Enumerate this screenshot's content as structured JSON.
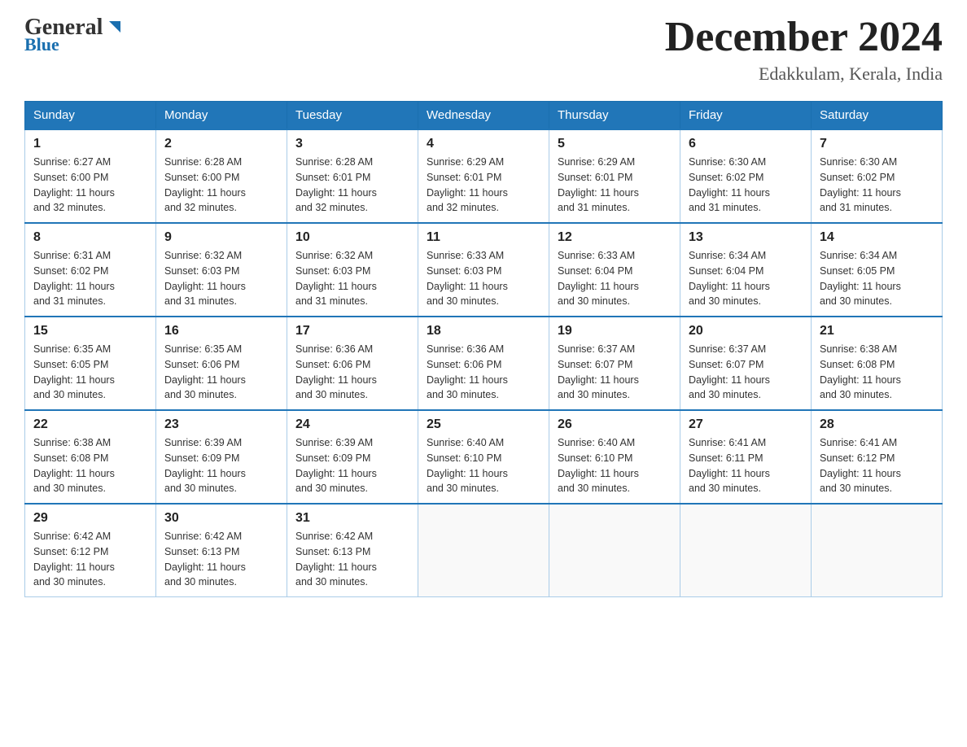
{
  "header": {
    "logo_general": "General",
    "logo_blue": "Blue",
    "month_title": "December 2024",
    "location": "Edakkulam, Kerala, India"
  },
  "weekdays": [
    "Sunday",
    "Monday",
    "Tuesday",
    "Wednesday",
    "Thursday",
    "Friday",
    "Saturday"
  ],
  "weeks": [
    [
      {
        "num": "1",
        "sunrise": "6:27 AM",
        "sunset": "6:00 PM",
        "daylight": "11 hours and 32 minutes."
      },
      {
        "num": "2",
        "sunrise": "6:28 AM",
        "sunset": "6:00 PM",
        "daylight": "11 hours and 32 minutes."
      },
      {
        "num": "3",
        "sunrise": "6:28 AM",
        "sunset": "6:01 PM",
        "daylight": "11 hours and 32 minutes."
      },
      {
        "num": "4",
        "sunrise": "6:29 AM",
        "sunset": "6:01 PM",
        "daylight": "11 hours and 32 minutes."
      },
      {
        "num": "5",
        "sunrise": "6:29 AM",
        "sunset": "6:01 PM",
        "daylight": "11 hours and 31 minutes."
      },
      {
        "num": "6",
        "sunrise": "6:30 AM",
        "sunset": "6:02 PM",
        "daylight": "11 hours and 31 minutes."
      },
      {
        "num": "7",
        "sunrise": "6:30 AM",
        "sunset": "6:02 PM",
        "daylight": "11 hours and 31 minutes."
      }
    ],
    [
      {
        "num": "8",
        "sunrise": "6:31 AM",
        "sunset": "6:02 PM",
        "daylight": "11 hours and 31 minutes."
      },
      {
        "num": "9",
        "sunrise": "6:32 AM",
        "sunset": "6:03 PM",
        "daylight": "11 hours and 31 minutes."
      },
      {
        "num": "10",
        "sunrise": "6:32 AM",
        "sunset": "6:03 PM",
        "daylight": "11 hours and 31 minutes."
      },
      {
        "num": "11",
        "sunrise": "6:33 AM",
        "sunset": "6:03 PM",
        "daylight": "11 hours and 30 minutes."
      },
      {
        "num": "12",
        "sunrise": "6:33 AM",
        "sunset": "6:04 PM",
        "daylight": "11 hours and 30 minutes."
      },
      {
        "num": "13",
        "sunrise": "6:34 AM",
        "sunset": "6:04 PM",
        "daylight": "11 hours and 30 minutes."
      },
      {
        "num": "14",
        "sunrise": "6:34 AM",
        "sunset": "6:05 PM",
        "daylight": "11 hours and 30 minutes."
      }
    ],
    [
      {
        "num": "15",
        "sunrise": "6:35 AM",
        "sunset": "6:05 PM",
        "daylight": "11 hours and 30 minutes."
      },
      {
        "num": "16",
        "sunrise": "6:35 AM",
        "sunset": "6:06 PM",
        "daylight": "11 hours and 30 minutes."
      },
      {
        "num": "17",
        "sunrise": "6:36 AM",
        "sunset": "6:06 PM",
        "daylight": "11 hours and 30 minutes."
      },
      {
        "num": "18",
        "sunrise": "6:36 AM",
        "sunset": "6:06 PM",
        "daylight": "11 hours and 30 minutes."
      },
      {
        "num": "19",
        "sunrise": "6:37 AM",
        "sunset": "6:07 PM",
        "daylight": "11 hours and 30 minutes."
      },
      {
        "num": "20",
        "sunrise": "6:37 AM",
        "sunset": "6:07 PM",
        "daylight": "11 hours and 30 minutes."
      },
      {
        "num": "21",
        "sunrise": "6:38 AM",
        "sunset": "6:08 PM",
        "daylight": "11 hours and 30 minutes."
      }
    ],
    [
      {
        "num": "22",
        "sunrise": "6:38 AM",
        "sunset": "6:08 PM",
        "daylight": "11 hours and 30 minutes."
      },
      {
        "num": "23",
        "sunrise": "6:39 AM",
        "sunset": "6:09 PM",
        "daylight": "11 hours and 30 minutes."
      },
      {
        "num": "24",
        "sunrise": "6:39 AM",
        "sunset": "6:09 PM",
        "daylight": "11 hours and 30 minutes."
      },
      {
        "num": "25",
        "sunrise": "6:40 AM",
        "sunset": "6:10 PM",
        "daylight": "11 hours and 30 minutes."
      },
      {
        "num": "26",
        "sunrise": "6:40 AM",
        "sunset": "6:10 PM",
        "daylight": "11 hours and 30 minutes."
      },
      {
        "num": "27",
        "sunrise": "6:41 AM",
        "sunset": "6:11 PM",
        "daylight": "11 hours and 30 minutes."
      },
      {
        "num": "28",
        "sunrise": "6:41 AM",
        "sunset": "6:12 PM",
        "daylight": "11 hours and 30 minutes."
      }
    ],
    [
      {
        "num": "29",
        "sunrise": "6:42 AM",
        "sunset": "6:12 PM",
        "daylight": "11 hours and 30 minutes."
      },
      {
        "num": "30",
        "sunrise": "6:42 AM",
        "sunset": "6:13 PM",
        "daylight": "11 hours and 30 minutes."
      },
      {
        "num": "31",
        "sunrise": "6:42 AM",
        "sunset": "6:13 PM",
        "daylight": "11 hours and 30 minutes."
      },
      null,
      null,
      null,
      null
    ]
  ],
  "labels": {
    "sunrise": "Sunrise:",
    "sunset": "Sunset:",
    "daylight": "Daylight:"
  },
  "colors": {
    "header_bg": "#2176b8",
    "header_text": "#ffffff",
    "border": "#aacce8"
  }
}
